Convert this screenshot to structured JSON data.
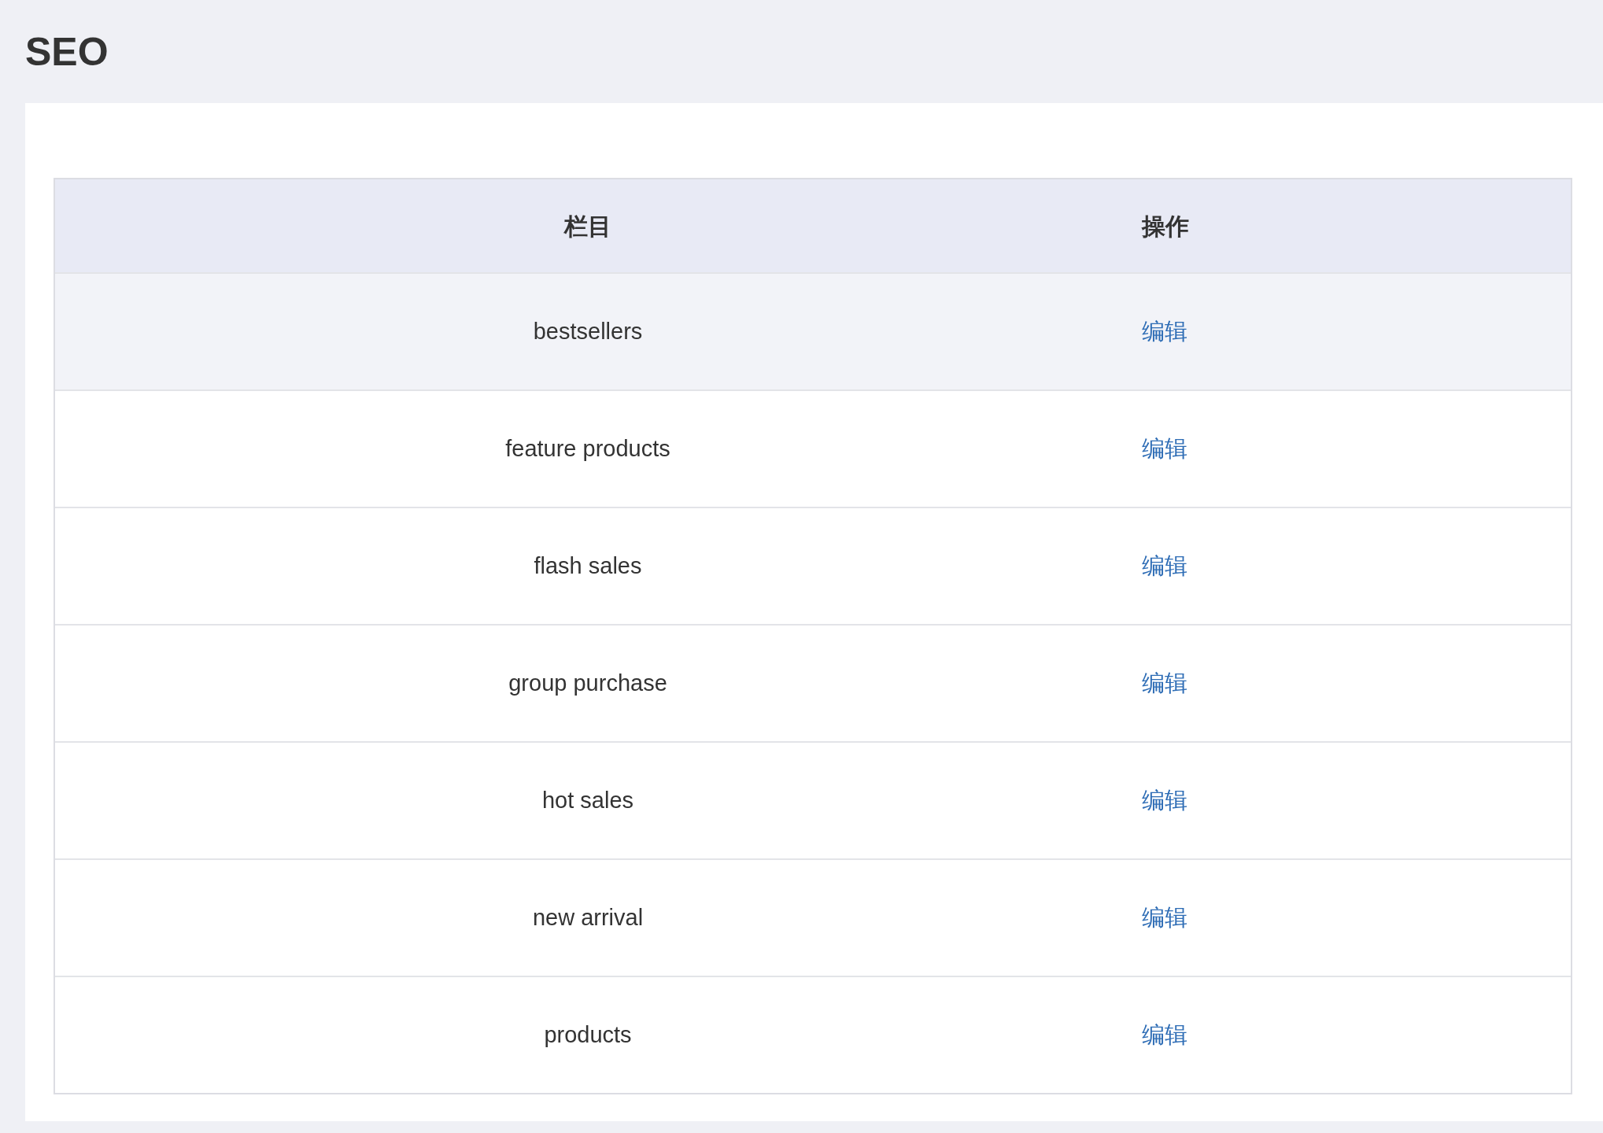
{
  "page_title": "SEO",
  "table": {
    "columns": [
      "栏目",
      "操作"
    ],
    "rows": [
      {
        "name": "bestsellers",
        "action": "编辑",
        "highlighted": true
      },
      {
        "name": "feature products",
        "action": "编辑",
        "highlighted": false
      },
      {
        "name": "flash sales",
        "action": "编辑",
        "highlighted": false
      },
      {
        "name": "group purchase",
        "action": "编辑",
        "highlighted": false
      },
      {
        "name": "hot sales",
        "action": "编辑",
        "highlighted": false
      },
      {
        "name": "new arrival",
        "action": "编辑",
        "highlighted": false
      },
      {
        "name": "products",
        "action": "编辑",
        "highlighted": false
      }
    ]
  }
}
